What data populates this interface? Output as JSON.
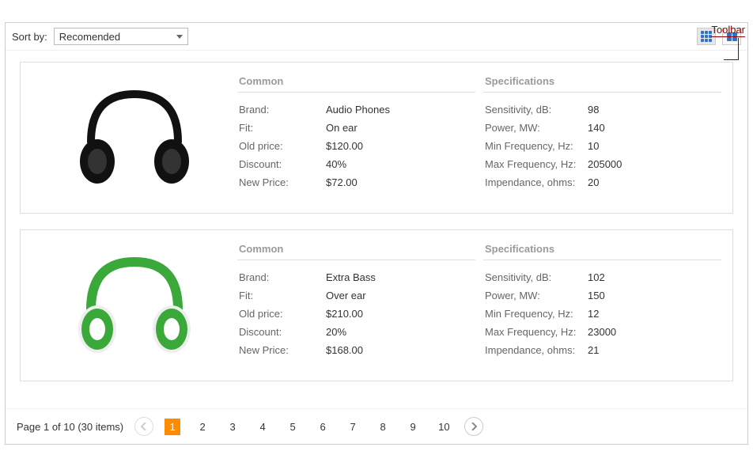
{
  "annotation": "Toolbar",
  "toolbar": {
    "sort_label": "Sort by:",
    "sort_value": "Recomended"
  },
  "items": [
    {
      "image": "headphones-black",
      "common_title": "Common",
      "specs_title": "Specifications",
      "common": [
        {
          "label": "Brand:",
          "value": "Audio Phones"
        },
        {
          "label": "Fit:",
          "value": "On ear"
        },
        {
          "label": "Old price:",
          "value": "$120.00"
        },
        {
          "label": "Discount:",
          "value": "40%"
        },
        {
          "label": "New Price:",
          "value": "$72.00"
        }
      ],
      "specs": [
        {
          "label": "Sensitivity, dB:",
          "value": "98"
        },
        {
          "label": "Power, MW:",
          "value": "140"
        },
        {
          "label": "Min Frequency, Hz:",
          "value": "10"
        },
        {
          "label": "Max Frequency, Hz:",
          "value": "205000"
        },
        {
          "label": "Impendance, ohms:",
          "value": "20"
        }
      ]
    },
    {
      "image": "headphones-green",
      "common_title": "Common",
      "specs_title": "Specifications",
      "common": [
        {
          "label": "Brand:",
          "value": "Extra Bass"
        },
        {
          "label": "Fit:",
          "value": "Over ear"
        },
        {
          "label": "Old price:",
          "value": "$210.00"
        },
        {
          "label": "Discount:",
          "value": "20%"
        },
        {
          "label": "New Price:",
          "value": "$168.00"
        }
      ],
      "specs": [
        {
          "label": "Sensitivity, dB:",
          "value": "102"
        },
        {
          "label": "Power, MW:",
          "value": "150"
        },
        {
          "label": "Min Frequency, Hz:",
          "value": "12"
        },
        {
          "label": "Max Frequency, Hz:",
          "value": "23000"
        },
        {
          "label": "Impendance, ohms:",
          "value": "21"
        }
      ]
    }
  ],
  "pager": {
    "status": "Page 1 of 10 (30 items)",
    "pages": [
      "1",
      "2",
      "3",
      "4",
      "5",
      "6",
      "7",
      "8",
      "9",
      "10"
    ],
    "active": "1"
  }
}
